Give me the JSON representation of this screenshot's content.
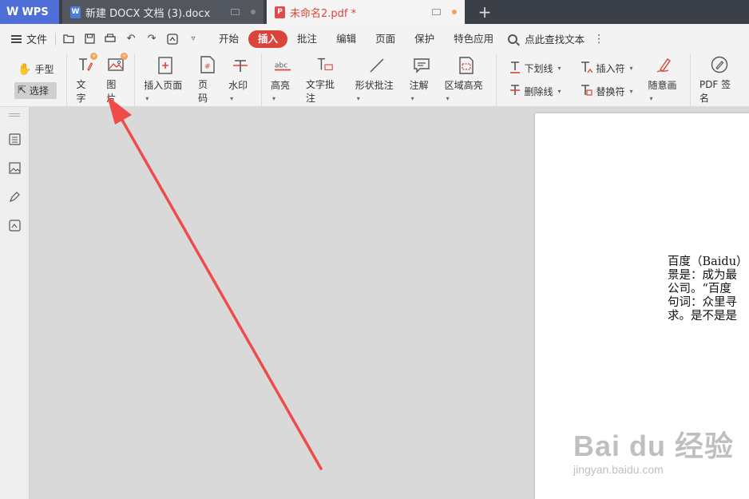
{
  "tabs": {
    "app": "WPS",
    "docx": {
      "title": "新建 DOCX 文档 (3).docx"
    },
    "pdf": {
      "title": "未命名2.pdf *"
    },
    "new_tab": "+"
  },
  "menu": {
    "file": "文件",
    "tabs": [
      "开始",
      "插入",
      "批注",
      "编辑",
      "页面",
      "保护",
      "特色应用"
    ],
    "active_tab": "插入",
    "search": "点此查找文本",
    "more": "⋮"
  },
  "ribbon": {
    "hand": "手型",
    "select": "选择",
    "text": "文字",
    "image": "图片",
    "insert_page": "插入页面",
    "page_number": "页码",
    "watermark": "水印",
    "highlight": "高亮",
    "text_comment": "文字批注",
    "shape_comment": "形状批注",
    "note": "注解",
    "area_highlight": "区域高亮",
    "underline": "下划线",
    "strikethrough": "删除线",
    "insert_symbol": "插入符",
    "replace_symbol": "替换符",
    "freehand": "随意画",
    "pdf_sign": "PDF 签名"
  },
  "document": {
    "lines": [
      "百度（Baidu）",
      "景是：成为最",
      "公司。“百度",
      "句词：众里寻",
      "求。是不是是"
    ]
  },
  "watermark": {
    "logo": "Bai du 经验",
    "url": "jingyan.baidu.com"
  },
  "colors": {
    "accent": "#d9453b",
    "arrow": "#f04a4a",
    "wps_blue": "#4e6fd8"
  }
}
